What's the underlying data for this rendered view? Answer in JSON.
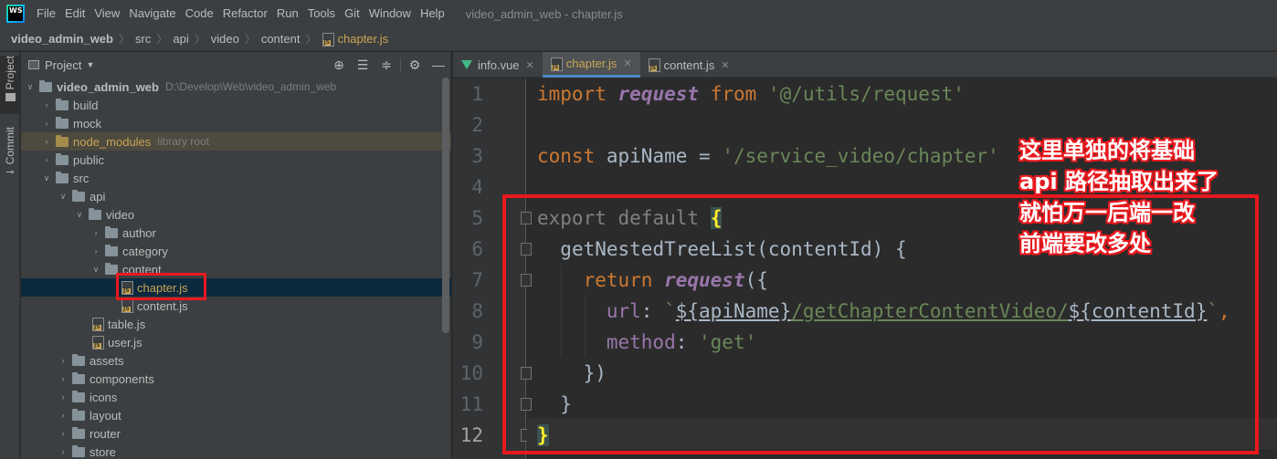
{
  "menubar": {
    "logo_text": "WS",
    "items": [
      "File",
      "Edit",
      "View",
      "Navigate",
      "Code",
      "Refactor",
      "Run",
      "Tools",
      "Git",
      "Window",
      "Help"
    ],
    "title": "video_admin_web - chapter.js"
  },
  "breadcrumb": {
    "items": [
      "video_admin_web",
      "src",
      "api",
      "video",
      "content",
      "chapter.js"
    ]
  },
  "sidestrip": {
    "project_tab": "Project",
    "commit_tab": "Commit"
  },
  "project_panel": {
    "title": "Project",
    "tools": [
      "target-icon",
      "expand-icon",
      "collapse-icon",
      "gear-icon",
      "minimize-icon"
    ],
    "tree": [
      {
        "label": "video_admin_web",
        "sub": "D:\\Develop\\Web\\video_admin_web",
        "type": "root"
      },
      {
        "label": "build",
        "type": "folder"
      },
      {
        "label": "mock",
        "type": "folder"
      },
      {
        "label": "node_modules",
        "sub": "library root",
        "type": "excluded"
      },
      {
        "label": "public",
        "type": "folder"
      },
      {
        "label": "src",
        "type": "folder"
      },
      {
        "label": "api",
        "type": "folder"
      },
      {
        "label": "video",
        "type": "folder"
      },
      {
        "label": "author",
        "type": "folder"
      },
      {
        "label": "category",
        "type": "folder"
      },
      {
        "label": "content",
        "type": "folder"
      },
      {
        "label": "chapter.js",
        "type": "file"
      },
      {
        "label": "content.js",
        "type": "file"
      },
      {
        "label": "table.js",
        "type": "file"
      },
      {
        "label": "user.js",
        "type": "file"
      },
      {
        "label": "assets",
        "type": "folder"
      },
      {
        "label": "components",
        "type": "folder"
      },
      {
        "label": "icons",
        "type": "folder"
      },
      {
        "label": "layout",
        "type": "folder"
      },
      {
        "label": "router",
        "type": "folder"
      },
      {
        "label": "store",
        "type": "folder"
      }
    ]
  },
  "editor_tabs": [
    {
      "label": "info.vue",
      "icon": "vue-icon"
    },
    {
      "label": "chapter.js",
      "icon": "js-file-icon",
      "active": true
    },
    {
      "label": "content.js",
      "icon": "js-file-icon"
    }
  ],
  "editor": {
    "line_numbers": [
      "1",
      "2",
      "3",
      "4",
      "5",
      "6",
      "7",
      "8",
      "9",
      "10",
      "11",
      "12"
    ],
    "current_line": 12,
    "code": {
      "l1_import": "import",
      "l1_request": "request",
      "l1_from": "from",
      "l1_path": "'@/utils/request'",
      "l3_const": "const",
      "l3_name": "apiName",
      "l3_eq": "=",
      "l3_value": "'/service_video/chapter'",
      "l5_export": "export",
      "l5_default": "default",
      "l5_brace": "{",
      "l6_method": "getNestedTreeList",
      "l6_params": "(contentId) {",
      "l7_return": "return",
      "l7_request": "request",
      "l7_paren": "({",
      "l8_url": "url",
      "l8_colon": ": ",
      "l8_tick_open": "`",
      "l8_interp1": "${apiName}",
      "l8_mid": "/getChapterContentVideo/",
      "l8_interp2": "${contentId}",
      "l8_tick_close": "`",
      "l8_comma": ",",
      "l9_method": "method",
      "l9_colon": ": ",
      "l9_value": "'get'",
      "l10_close": "})",
      "l11_close": "}",
      "l12_close": "}"
    }
  },
  "annotation": {
    "lines": [
      "这里单独的将基础",
      "api 路径抽取出来了",
      "就怕万一后端一改",
      "前端要改多处"
    ]
  }
}
